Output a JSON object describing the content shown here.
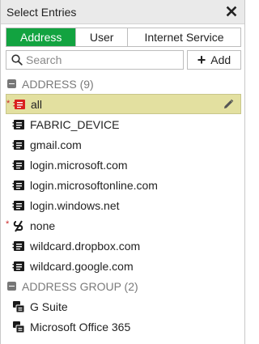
{
  "header": {
    "title": "Select Entries"
  },
  "tabs": [
    {
      "label": "Address",
      "active": true
    },
    {
      "label": "User",
      "active": false
    },
    {
      "label": "Internet Service",
      "active": false
    }
  ],
  "search": {
    "placeholder": "Search",
    "value": ""
  },
  "add_button": {
    "label": "Add"
  },
  "groups": [
    {
      "label": "ADDRESS (9)",
      "items": [
        {
          "label": "all",
          "icon": "address-subnet-icon",
          "required": true,
          "selected": true
        },
        {
          "label": "FABRIC_DEVICE",
          "icon": "address-icon"
        },
        {
          "label": "gmail.com",
          "icon": "address-icon"
        },
        {
          "label": "login.microsoft.com",
          "icon": "address-icon"
        },
        {
          "label": "login.microsoftonline.com",
          "icon": "address-icon"
        },
        {
          "label": "login.windows.net",
          "icon": "address-icon"
        },
        {
          "label": "none",
          "icon": "none-address-icon",
          "required": true
        },
        {
          "label": "wildcard.dropbox.com",
          "icon": "address-icon"
        },
        {
          "label": "wildcard.google.com",
          "icon": "address-icon"
        }
      ]
    },
    {
      "label": "ADDRESS GROUP (2)",
      "items": [
        {
          "label": "G Suite",
          "icon": "address-group-icon"
        },
        {
          "label": "Microsoft Office 365",
          "icon": "address-group-icon"
        }
      ]
    }
  ],
  "colors": {
    "accent": "#12a340",
    "selected_row": "#e3e0a0",
    "required_marker": "#cc2b2b"
  }
}
